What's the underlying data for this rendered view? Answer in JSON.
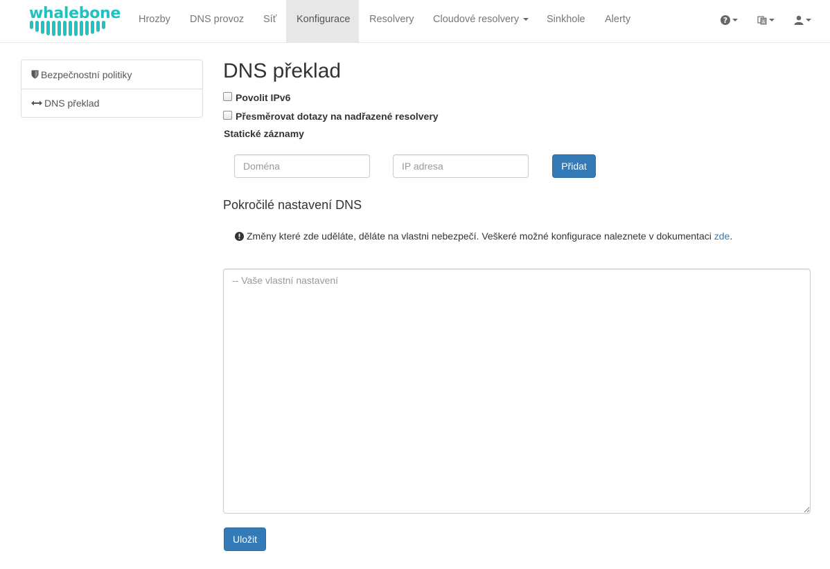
{
  "brand": {
    "name": "whalebone",
    "color": "#1fc1c1"
  },
  "nav": {
    "items": [
      {
        "label": "Hrozby",
        "active": false
      },
      {
        "label": "DNS provoz",
        "active": false
      },
      {
        "label": "Síť",
        "active": false
      },
      {
        "label": "Konfigurace",
        "active": true
      },
      {
        "label": "Resolvery",
        "active": false
      },
      {
        "label": "Cloudové resolvery",
        "active": false,
        "dropdown": true
      },
      {
        "label": "Sinkhole",
        "active": false
      },
      {
        "label": "Alerty",
        "active": false
      }
    ],
    "right_icons": [
      "help-icon",
      "language-icon",
      "user-icon"
    ]
  },
  "sidebar": {
    "items": [
      {
        "label": "Bezpečnostní politiky",
        "icon": "shield-icon"
      },
      {
        "label": "DNS překlad",
        "icon": "resize-horizontal-icon"
      }
    ]
  },
  "main": {
    "title": "DNS překlad",
    "checkboxes": [
      {
        "label": "Povolit IPv6",
        "checked": false
      },
      {
        "label": "Přesměrovat dotazy na nadřazené resolvery",
        "checked": false
      }
    ],
    "static_records": {
      "label": "Statické záznamy",
      "domain_placeholder": "Doména",
      "ip_placeholder": "IP adresa",
      "add_label": "Přidat"
    },
    "advanced": {
      "title": "Pokročilé nastavení DNS",
      "warning_text": "Změny které zde uděláte, děláte na vlastni nebezpečí. Veškeré možné konfigurace naleznete v dokumentaci",
      "warning_link": "zde",
      "warning_end": ".",
      "textarea_placeholder": "-- Vaše vlastní nastavení",
      "save_label": "Uložit"
    }
  },
  "colors": {
    "primary": "#337ab7",
    "link": "#337ab7",
    "active_nav_bg": "#e7e7e7"
  }
}
